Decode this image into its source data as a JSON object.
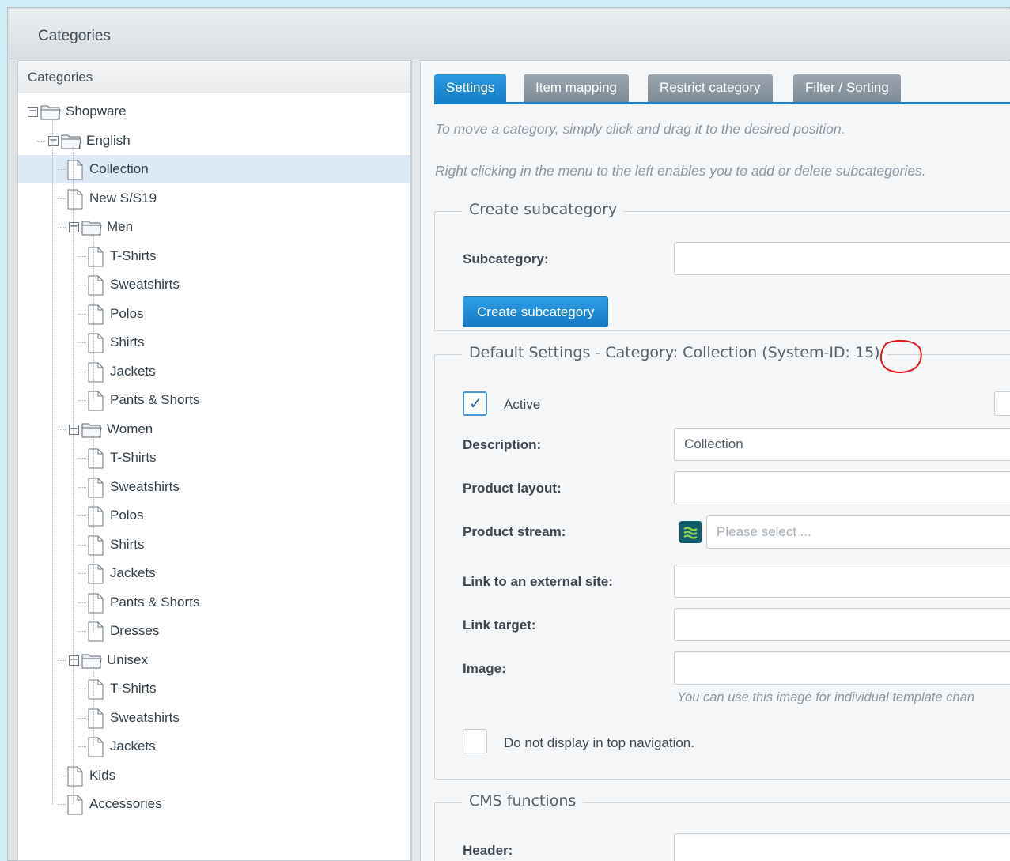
{
  "window": {
    "title": "Categories"
  },
  "tree": {
    "header": "Categories",
    "nodes": [
      {
        "label": "Shopware",
        "type": "folder",
        "level": 0,
        "expanded": true,
        "selected": false
      },
      {
        "label": "English",
        "type": "folder",
        "level": 1,
        "expanded": true,
        "selected": false
      },
      {
        "label": "Collection",
        "type": "leaf",
        "level": 2,
        "selected": true
      },
      {
        "label": "New S/S19",
        "type": "leaf",
        "level": 2,
        "selected": false
      },
      {
        "label": "Men",
        "type": "folder",
        "level": 2,
        "expanded": true,
        "selected": false
      },
      {
        "label": "T-Shirts",
        "type": "leaf",
        "level": 3,
        "selected": false
      },
      {
        "label": "Sweatshirts",
        "type": "leaf",
        "level": 3,
        "selected": false
      },
      {
        "label": "Polos",
        "type": "leaf",
        "level": 3,
        "selected": false
      },
      {
        "label": "Shirts",
        "type": "leaf",
        "level": 3,
        "selected": false
      },
      {
        "label": "Jackets",
        "type": "leaf",
        "level": 3,
        "selected": false
      },
      {
        "label": "Pants & Shorts",
        "type": "leaf",
        "level": 3,
        "selected": false
      },
      {
        "label": "Women",
        "type": "folder",
        "level": 2,
        "expanded": true,
        "selected": false
      },
      {
        "label": "T-Shirts",
        "type": "leaf",
        "level": 3,
        "selected": false
      },
      {
        "label": "Sweatshirts",
        "type": "leaf",
        "level": 3,
        "selected": false
      },
      {
        "label": "Polos",
        "type": "leaf",
        "level": 3,
        "selected": false
      },
      {
        "label": "Shirts",
        "type": "leaf",
        "level": 3,
        "selected": false
      },
      {
        "label": "Jackets",
        "type": "leaf",
        "level": 3,
        "selected": false
      },
      {
        "label": "Pants & Shorts",
        "type": "leaf",
        "level": 3,
        "selected": false
      },
      {
        "label": "Dresses",
        "type": "leaf",
        "level": 3,
        "selected": false
      },
      {
        "label": "Unisex",
        "type": "folder",
        "level": 2,
        "expanded": true,
        "selected": false
      },
      {
        "label": "T-Shirts",
        "type": "leaf",
        "level": 3,
        "selected": false
      },
      {
        "label": "Sweatshirts",
        "type": "leaf",
        "level": 3,
        "selected": false
      },
      {
        "label": "Jackets",
        "type": "leaf",
        "level": 3,
        "selected": false
      },
      {
        "label": "Kids",
        "type": "leaf",
        "level": 2,
        "selected": false
      },
      {
        "label": "Accessories",
        "type": "leaf",
        "level": 2,
        "selected": false
      }
    ]
  },
  "tabs": [
    {
      "label": "Settings",
      "active": true
    },
    {
      "label": "Item mapping",
      "active": false
    },
    {
      "label": "Restrict category",
      "active": false
    },
    {
      "label": "Filter / Sorting",
      "active": false
    }
  ],
  "hints": {
    "move": "To move a category, simply click and drag it to the desired position.",
    "rightclick": "Right clicking in the menu to the left enables you to add or delete subcategories."
  },
  "create_subcategory": {
    "legend": "Create subcategory",
    "subcategory_label": "Subcategory:",
    "subcategory_value": "",
    "button_label": "Create subcategory"
  },
  "default_settings": {
    "legend": "Default Settings - Category: Collection (System-ID: 15)",
    "active_label": "Active",
    "active_checked": true,
    "description_label": "Description:",
    "description_value": "Collection",
    "product_layout_label": "Product layout:",
    "product_layout_value": "",
    "product_stream_label": "Product stream:",
    "product_stream_placeholder": "Please select ...",
    "external_link_label": "Link to an external site:",
    "external_link_value": "",
    "link_target_label": "Link target:",
    "link_target_value": "",
    "image_label": "Image:",
    "image_value": "",
    "image_hint": "You can use this image for individual template chan",
    "hide_top_nav_label": "Do not display in top navigation.",
    "hide_top_nav_checked": false
  },
  "cms": {
    "legend": "CMS functions",
    "header_label": "Header:",
    "header_value": ""
  },
  "colors": {
    "accent": "#1b83cb",
    "selected_row": "#dde9f5",
    "annotation": "#e0161d"
  }
}
